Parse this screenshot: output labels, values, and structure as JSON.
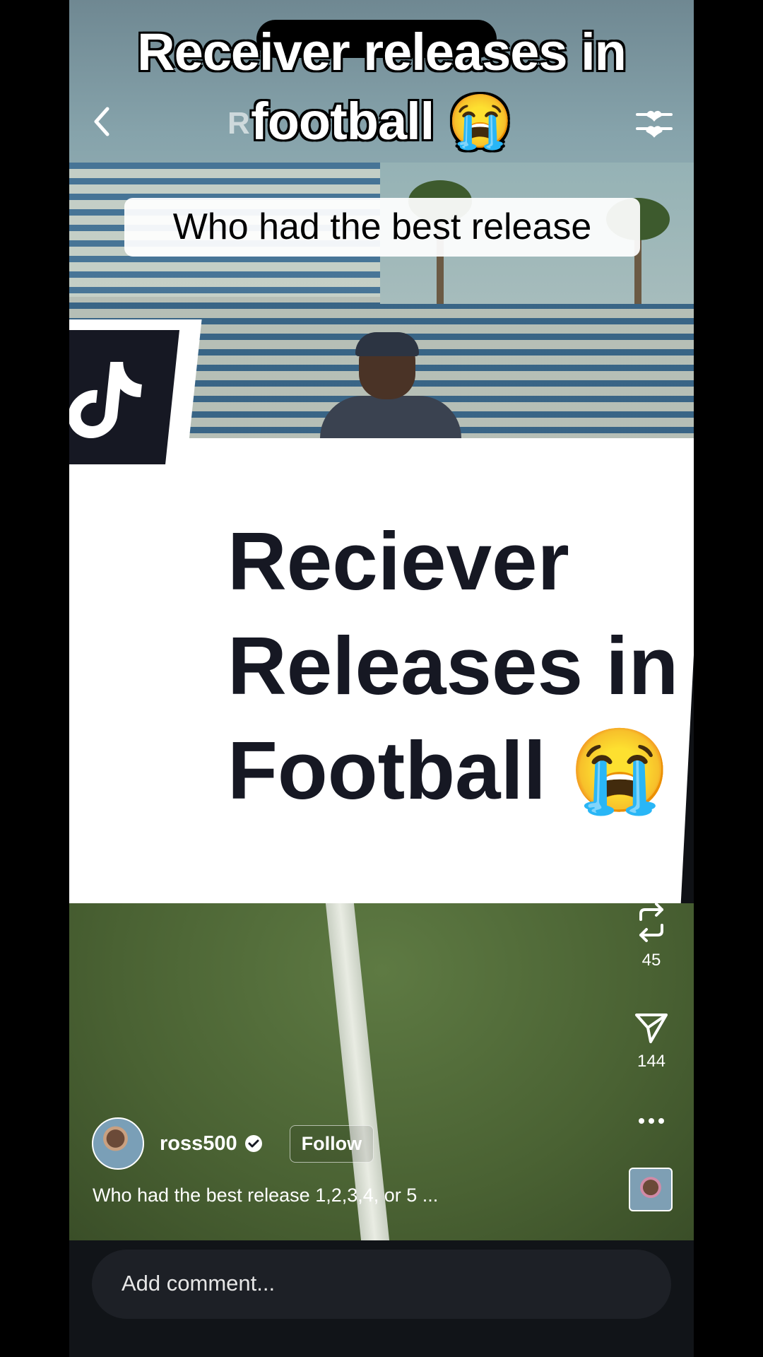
{
  "video": {
    "top_caption_line1": "Receiver releases in",
    "top_caption_line2": "football 😭",
    "underlying_title": "R",
    "question": "Who had the best release"
  },
  "card": {
    "line1": "Reciever",
    "line2": "Releases in",
    "line3": "Football 😭"
  },
  "icons": {
    "back": "chevron-left-icon",
    "filter": "filter-heart-icon",
    "logo": "tiktok-logo-icon",
    "repost": "repost-icon",
    "share": "share-icon",
    "more": "more-icon",
    "verified": "verified-badge-icon"
  },
  "rail": {
    "repost_count": "45",
    "share_count": "144"
  },
  "creator": {
    "username": "ross500",
    "follow_label": "Follow",
    "description": "Who had the best release 1,2,3,4, or 5 ..."
  },
  "comment": {
    "placeholder": "Add comment..."
  },
  "colors": {
    "card_text": "#161823",
    "logo_bg": "#161823",
    "comment_bg": "#1d2026"
  }
}
